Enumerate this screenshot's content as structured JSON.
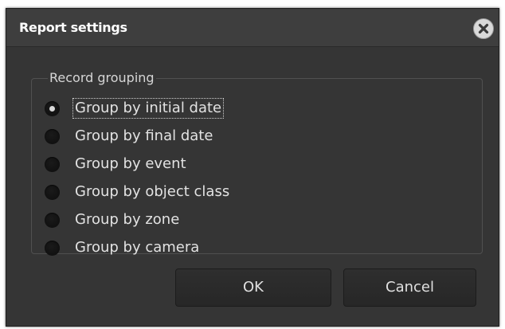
{
  "dialog": {
    "title": "Report settings",
    "close_icon": "close-icon"
  },
  "grouping": {
    "legend": "Record grouping",
    "options": [
      {
        "label": "Group by initial date",
        "checked": true,
        "focused": true
      },
      {
        "label": "Group by final date",
        "checked": false,
        "focused": false
      },
      {
        "label": "Group by event",
        "checked": false,
        "focused": false
      },
      {
        "label": "Group by object class",
        "checked": false,
        "focused": false
      },
      {
        "label": "Group by zone",
        "checked": false,
        "focused": false
      },
      {
        "label": "Group by camera",
        "checked": false,
        "focused": false
      }
    ]
  },
  "buttons": {
    "ok_label": "OK",
    "cancel_label": "Cancel"
  },
  "colors": {
    "dialog_bg": "#353535",
    "titlebar_bg": "#3e3e3e",
    "text": "#e2e2e2"
  }
}
